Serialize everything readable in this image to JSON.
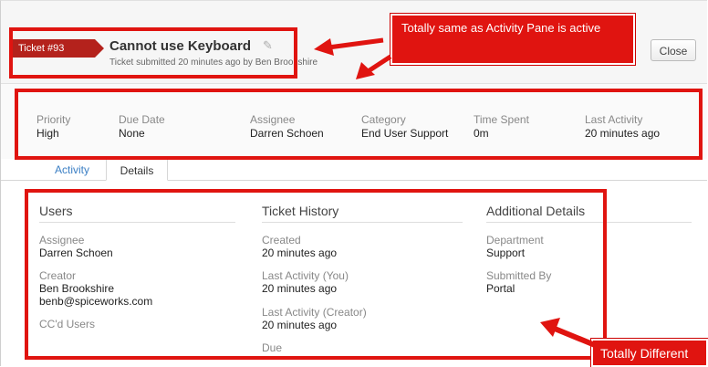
{
  "ticket": {
    "tag": "Ticket #93",
    "title": "Cannot use Keyboard",
    "subtitle": "Ticket submitted 20 minutes ago by Ben Brookshire"
  },
  "header": {
    "close_label": "Close"
  },
  "fields": [
    {
      "label": "Priority",
      "value": "High"
    },
    {
      "label": "Due Date",
      "value": "None"
    },
    {
      "label": "Assignee",
      "value": "Darren Schoen"
    },
    {
      "label": "Category",
      "value": "End User Support"
    },
    {
      "label": "Time Spent",
      "value": "0m"
    },
    {
      "label": "Last Activity",
      "value": "20 minutes ago"
    }
  ],
  "tabs": [
    {
      "label": "Activity"
    },
    {
      "label": "Details"
    }
  ],
  "details": {
    "users": {
      "title": "Users",
      "assignee_label": "Assignee",
      "assignee_value": "Darren Schoen",
      "creator_label": "Creator",
      "creator_name": "Ben Brookshire",
      "creator_email": "benb@spiceworks.com",
      "ccd_label": "CC'd Users"
    },
    "history": {
      "title": "Ticket History",
      "created_label": "Created",
      "created_value": "20 minutes ago",
      "last_you_label": "Last Activity (You)",
      "last_you_value": "20 minutes ago",
      "last_creator_label": "Last Activity (Creator)",
      "last_creator_value": "20 minutes ago",
      "due_label": "Due"
    },
    "additional": {
      "title": "Additional Details",
      "department_label": "Department",
      "department_value": "Support",
      "submitted_by_label": "Submitted By",
      "submitted_by_value": "Portal"
    }
  },
  "annotations": {
    "callout_top": "Totally same as Activity Pane is active",
    "callout_bottom": "Totally Different"
  },
  "colors": {
    "annotation_red": "#e01410",
    "ticket_tag": "#b4221c",
    "link_blue": "#3b7fc4"
  }
}
